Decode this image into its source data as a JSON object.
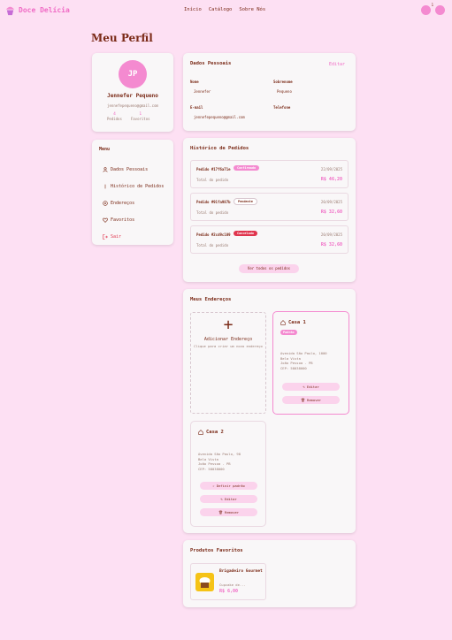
{
  "brand": {
    "name": "Doce Delícia"
  },
  "nav": {
    "items": [
      "Início",
      "Catálogo",
      "Sobre Nós"
    ]
  },
  "header": {
    "badge_count": "1"
  },
  "page": {
    "title": "Meu Perfil"
  },
  "profile": {
    "initials": "JP",
    "name": "Jennefer Pequeno",
    "email": "jennefepequeno@gmail.com",
    "stats": [
      {
        "value": "4",
        "label": "Pedidos"
      },
      {
        "value": "1",
        "label": "Favoritos"
      }
    ]
  },
  "menu": {
    "title": "Menu",
    "items": [
      {
        "label": "Dados Pessoais",
        "icon": "user-icon"
      },
      {
        "label": "Histórico de Pedidos",
        "icon": "list-icon"
      },
      {
        "label": "Endereços",
        "icon": "location-icon"
      },
      {
        "label": "Favoritos",
        "icon": "heart-icon"
      },
      {
        "label": "Sair",
        "icon": "logout-icon"
      }
    ]
  },
  "personal": {
    "title": "Dados Pessoais",
    "edit_label": "Editar",
    "fields": [
      {
        "label": "Nome",
        "value": "Jennefer"
      },
      {
        "label": "Sobrenome",
        "value": "Pequeno"
      },
      {
        "label": "E-mail",
        "value": "jennefepequeno@gmail.com"
      },
      {
        "label": "Telefone",
        "value": ""
      }
    ]
  },
  "history": {
    "title": "Histórico de Pedidos",
    "orders": [
      {
        "id": "Pedido #17f6a71e",
        "status": "Confirmado",
        "date": "22/09/2025",
        "total_label": "Total do pedido",
        "total": "R$ 46,20",
        "status_color": "#f48ad0"
      },
      {
        "id": "Pedido #91fa987b",
        "status": "Pendente",
        "date": "20/09/2025",
        "total_label": "Total do pedido",
        "total": "R$ 32,60",
        "status_color": "#ffffff"
      },
      {
        "id": "Pedido #2cd9c109",
        "status": "Cancelado",
        "date": "20/09/2025",
        "total_label": "Total do pedido",
        "total": "R$ 32,60",
        "status_color": "#e0354e"
      }
    ],
    "see_all_label": "Ver todos os pedidos"
  },
  "addresses": {
    "title": "Meus Endereços",
    "add": {
      "title": "Adicionar Endereço",
      "subtitle": "Clique para criar um novo endereço"
    },
    "items": [
      {
        "name": "Casa 1",
        "default_badge": "Padrão",
        "lines": [
          "Avenida São Paulo, 1000",
          "Bela Vista",
          "João Pessoa - PB",
          "CEP: 58038000"
        ],
        "buttons": [
          "Editar",
          "Remover"
        ]
      },
      {
        "name": "Casa 2",
        "lines": [
          "Avenida São Paulo, 98",
          "Bela Vista",
          "João Pessoa - PB",
          "CEP: 58038000"
        ],
        "buttons": [
          "Definir padrão",
          "Editar",
          "Remover"
        ]
      }
    ]
  },
  "favorites": {
    "title": "Produtos Favoritos",
    "items": [
      {
        "name": "Brigadeiro Gourmet",
        "desc": "Cupcake de...",
        "price": "R$ 6,00"
      }
    ]
  }
}
